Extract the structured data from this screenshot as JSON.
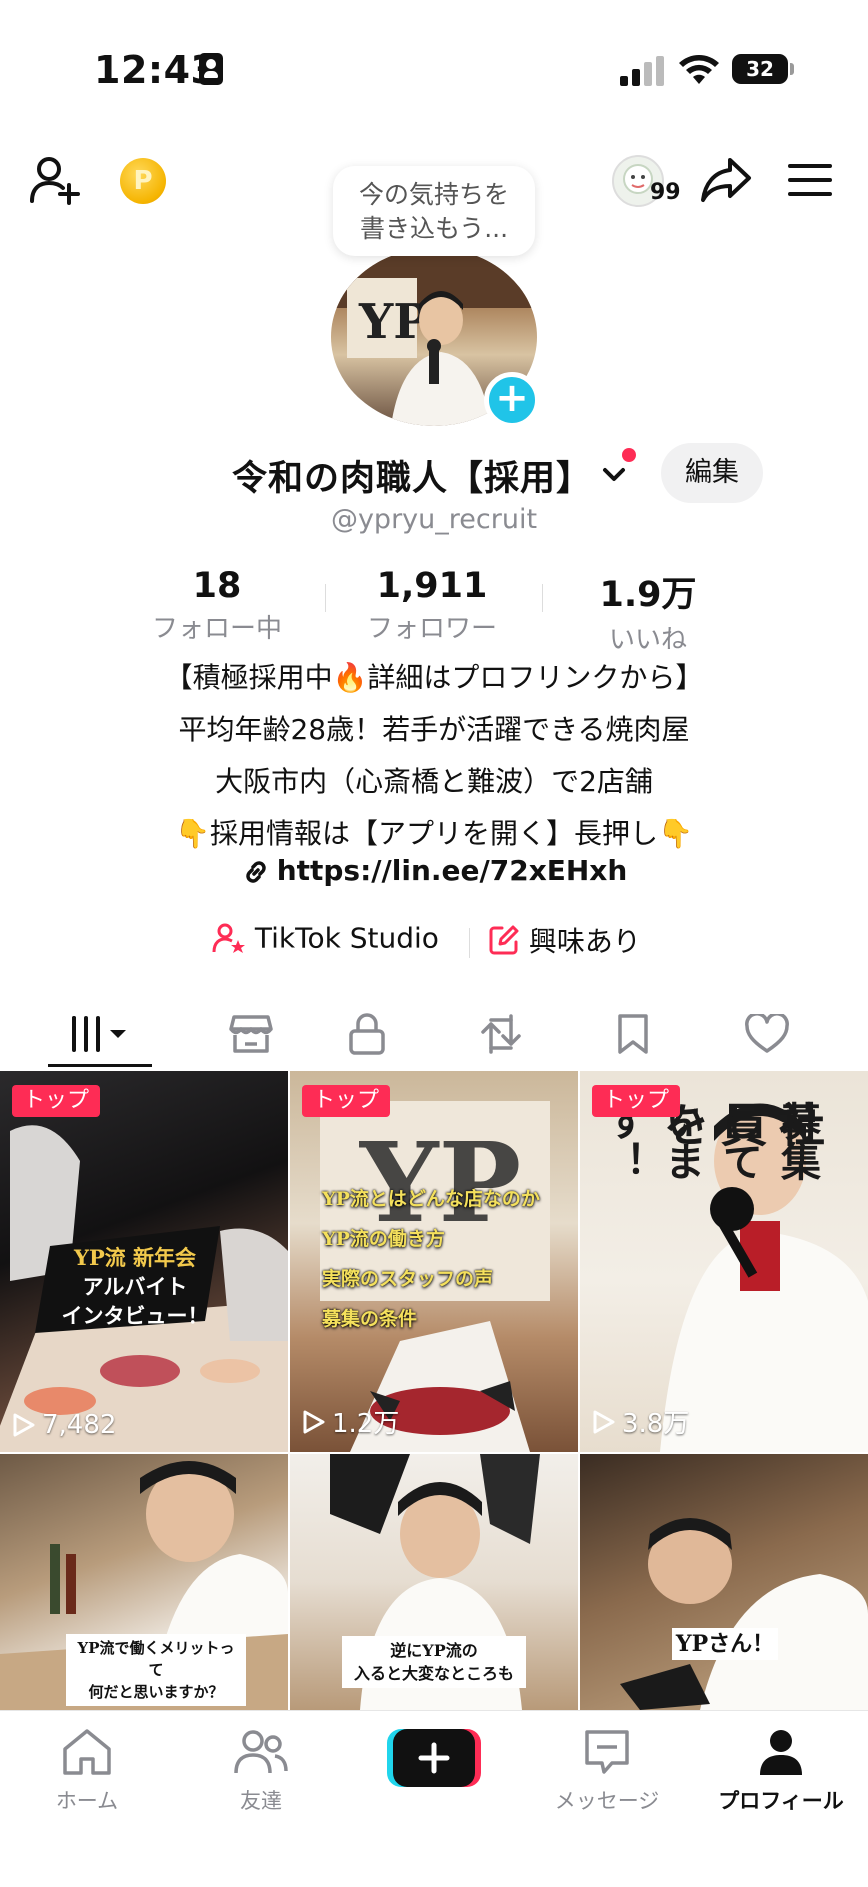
{
  "status_bar": {
    "time": "12:43",
    "battery": "32"
  },
  "header": {
    "avatar_badge_count": "99",
    "mood_bubble": "今の気持ちを書き込もう..."
  },
  "profile": {
    "display_name": "令和の肉職人【採用】",
    "edit_label": "編集",
    "username": "@ypryu_recruit"
  },
  "stats": [
    {
      "value": "18",
      "label": "フォロー中"
    },
    {
      "value": "1,911",
      "label": "フォロワー"
    },
    {
      "value": "1.9万",
      "label": "いいね"
    }
  ],
  "bio": {
    "line1": "【積極採用中🔥詳細はプロフリンクから】",
    "line2": "平均年齢28歳！若手が活躍できる焼肉屋",
    "line3": "大阪市内（心斎橋と難波）で2店舗",
    "line4": "👇採用情報は【アプリを開く】長押し👇",
    "link": "https://lin.ee/72xEHxh"
  },
  "quick_links": {
    "studio": "TikTok Studio",
    "interest": "興味あり"
  },
  "tabs": [
    "videos-icon",
    "shop-icon",
    "private-lock-icon",
    "repost-icon",
    "bookmark-icon",
    "liked-heart-icon"
  ],
  "videos": [
    {
      "badge": "トップ",
      "views": "7,482",
      "caption_lines": [
        "YP流 新年会",
        "アルバイト",
        "インタビュー！"
      ]
    },
    {
      "badge": "トップ",
      "views": "1.2万",
      "caption_lines": [
        "YP流とはどんな店なのか",
        "YP流の働き方",
        "実際のスタッフの声",
        "募集の条件"
      ]
    },
    {
      "badge": "トップ",
      "views": "3.8万",
      "caption_lines": [
        "社員を",
        "募集しています！"
      ]
    },
    {
      "badge": "",
      "views": "",
      "caption_lines": [
        "YP流で働くメリットって",
        "何だと思いますか？"
      ]
    },
    {
      "badge": "",
      "views": "",
      "caption_lines": [
        "逆にYP流の",
        "入ると大変なところも"
      ]
    },
    {
      "badge": "",
      "views": "",
      "caption_lines": [
        "YPさん！"
      ]
    }
  ],
  "bottom_nav": {
    "home": "ホーム",
    "friends": "友達",
    "messages": "メッセージ",
    "profile": "プロフィール"
  },
  "colors": {
    "accent_red": "#fe2c55",
    "accent_cyan": "#20c4e8",
    "muted_text": "#8a8b91"
  }
}
